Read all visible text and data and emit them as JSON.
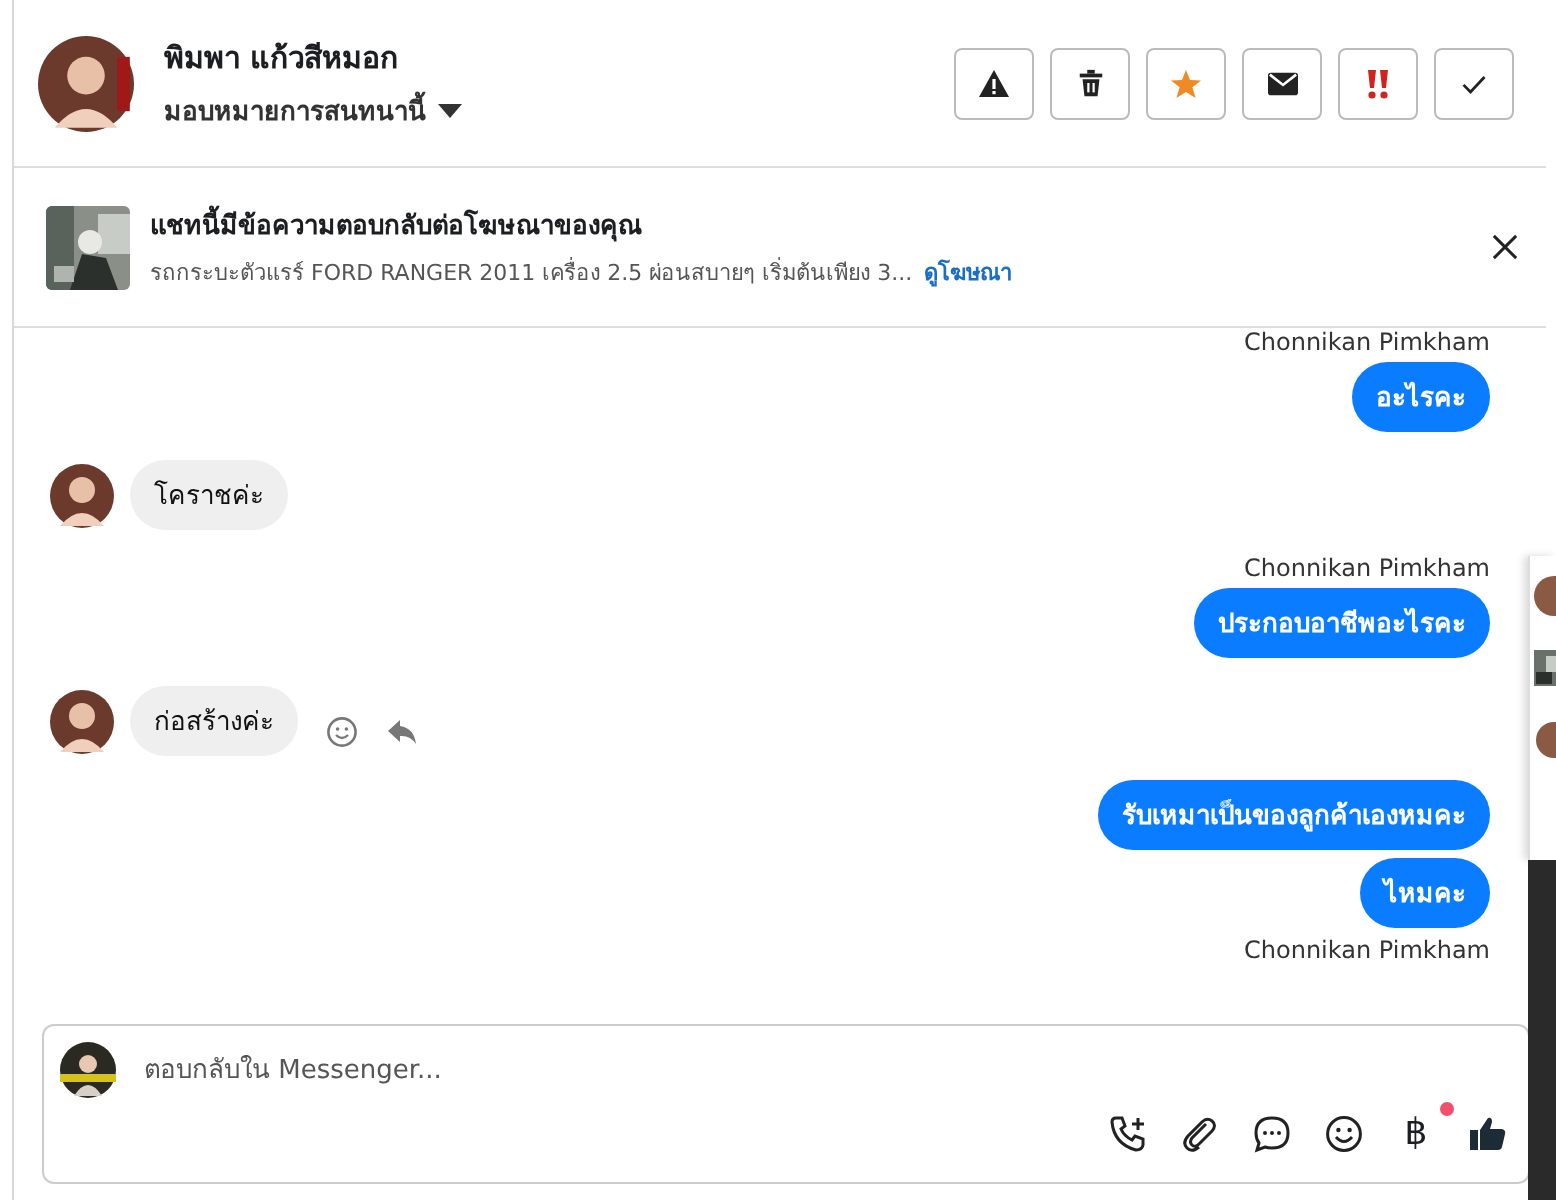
{
  "header": {
    "name": "พิมพา แก้วสีหมอก",
    "assign": "มอบหมายการสนทนานี้",
    "actions": [
      {
        "kind": "spam"
      },
      {
        "kind": "delete"
      },
      {
        "kind": "star"
      },
      {
        "kind": "unread"
      },
      {
        "kind": "priority"
      },
      {
        "kind": "done"
      }
    ]
  },
  "ad_banner": {
    "title": "แชทนี้มีข้อความตอบกลับต่อโฆษณาของคุณ",
    "description": "รถกระบะตัวแรร์ FORD RANGER 2011 เครื่อง 2.5 ผ่อนสบายๆ เริ่มต้นเพียง 3...",
    "link": "ดูโฆษณา"
  },
  "messages": [
    {
      "kind": "name",
      "text": "Chonnikan Pimkham"
    },
    {
      "kind": "outgoing",
      "text": "อะไรคะ"
    },
    {
      "kind": "incoming",
      "text": "โคราชค่ะ",
      "actions": false
    },
    {
      "kind": "name",
      "text": "Chonnikan Pimkham"
    },
    {
      "kind": "outgoing",
      "text": "ประกอบอาชีพอะไรคะ"
    },
    {
      "kind": "incoming",
      "text": "ก่อสร้างค่ะ",
      "actions": true
    },
    {
      "kind": "outgoing",
      "text": "รับเหมาเป็นของลูกค้าเองหมคะ"
    },
    {
      "kind": "outgoing",
      "text": "ไหมคะ"
    },
    {
      "kind": "name",
      "text": "Chonnikan Pimkham"
    }
  ],
  "composer": {
    "placeholder": "ตอบกลับใน Messenger...",
    "tools": [
      {
        "kind": "call"
      },
      {
        "kind": "attach"
      },
      {
        "kind": "reply"
      },
      {
        "kind": "emoji"
      },
      {
        "kind": "payment",
        "glyph": "฿",
        "notification": true
      },
      {
        "kind": "like"
      }
    ]
  }
}
